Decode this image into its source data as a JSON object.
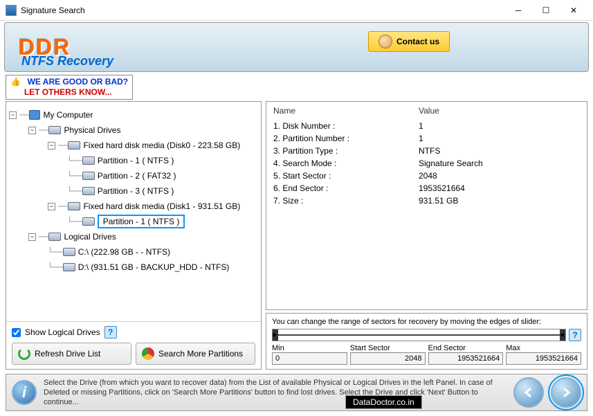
{
  "window": {
    "title": "Signature Search"
  },
  "header": {
    "logo": "DDR",
    "subtitle": "NTFS Recovery",
    "contact": "Contact us"
  },
  "feedback": {
    "line1": "WE ARE GOOD OR BAD?",
    "line2": "LET OTHERS KNOW..."
  },
  "tree": {
    "root": "My Computer",
    "physical": "Physical Drives",
    "disk0": "Fixed hard disk media (Disk0 - 223.58 GB)",
    "d0p1": "Partition - 1 ( NTFS )",
    "d0p2": "Partition - 2 ( FAT32 )",
    "d0p3": "Partition - 3 ( NTFS )",
    "disk1": "Fixed hard disk media (Disk1 - 931.51 GB)",
    "d1p1": "Partition - 1 ( NTFS )",
    "logical": "Logical Drives",
    "lc": "C:\\ (222.98 GB -  - NTFS)",
    "ld": "D:\\ (931.51 GB - BACKUP_HDD - NTFS)"
  },
  "left_controls": {
    "show_logical": "Show Logical Drives",
    "refresh": "Refresh Drive List",
    "search_more": "Search More Partitions"
  },
  "info": {
    "header_name": "Name",
    "header_value": "Value",
    "rows": [
      {
        "name": "1. Disk Number :",
        "value": "1"
      },
      {
        "name": "2. Partition Number :",
        "value": "1"
      },
      {
        "name": "3. Partition Type :",
        "value": "NTFS"
      },
      {
        "name": "4. Search Mode :",
        "value": "Signature Search"
      },
      {
        "name": "5. Start Sector :",
        "value": "2048"
      },
      {
        "name": "6. End Sector :",
        "value": "1953521664"
      },
      {
        "name": "7. Size :",
        "value": "931.51 GB"
      }
    ]
  },
  "sector": {
    "label": "You can change the range of sectors for recovery by moving the edges of slider:",
    "min_label": "Min",
    "min": "0",
    "start_label": "Start Sector",
    "start": "2048",
    "end_label": "End Sector",
    "end": "1953521664",
    "max_label": "Max",
    "max": "1953521664"
  },
  "footer": {
    "text": "Select the Drive (from which you want to recover data) from the List of available Physical or Logical Drives in the left Panel. In case of Deleted or missing Partitions, click on 'Search More Partitions' button to find lost drives. Select the Drive and click 'Next' Button to continue...",
    "badge": "DataDoctor.co.in"
  }
}
